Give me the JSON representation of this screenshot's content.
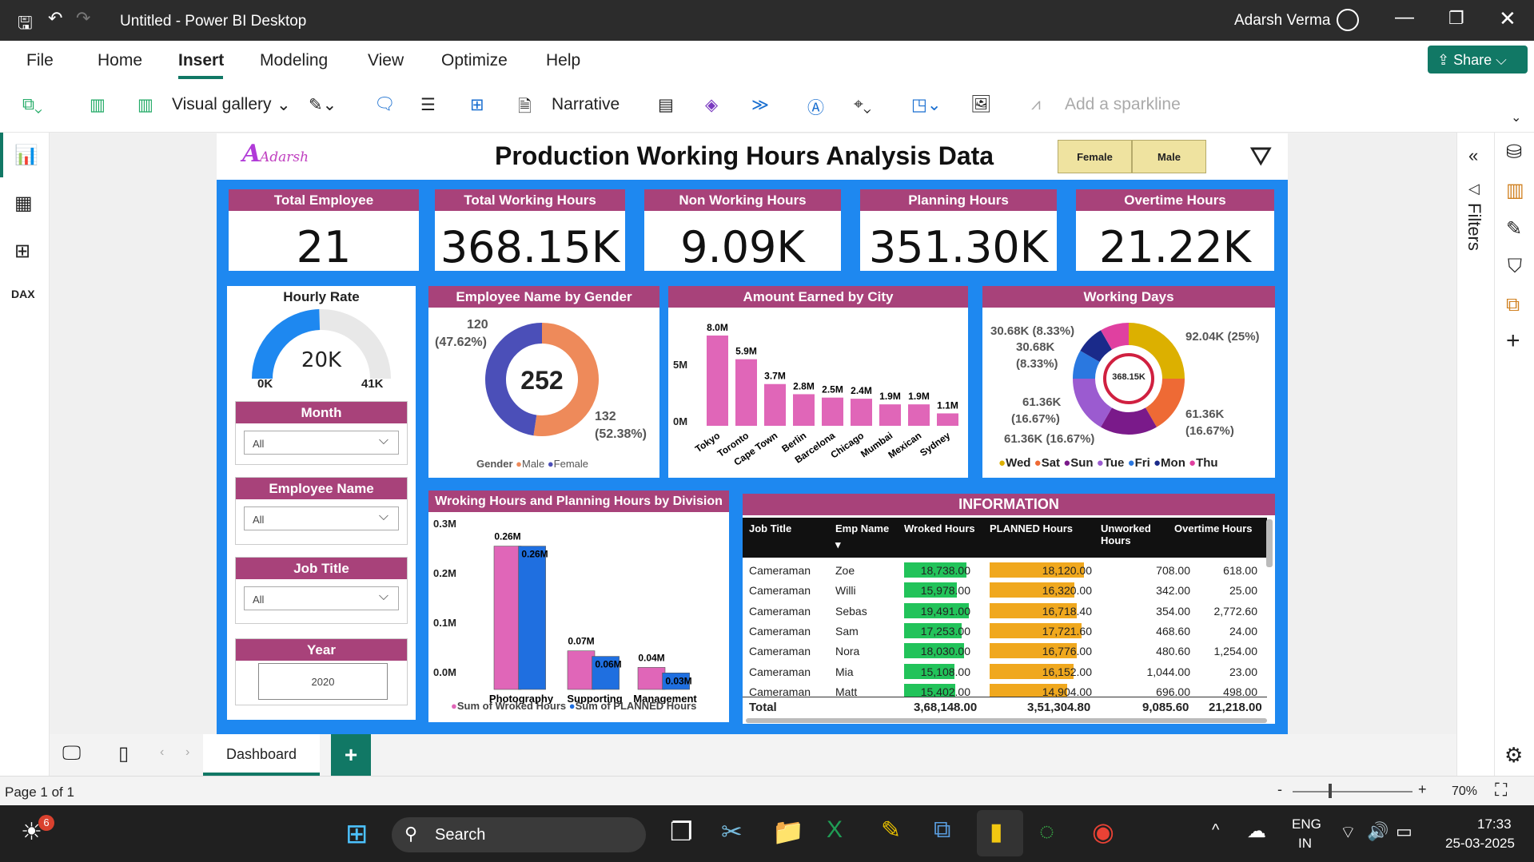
{
  "window": {
    "title": "Untitled - Power BI Desktop",
    "user": "Adarsh Verma"
  },
  "menu": [
    "File",
    "Home",
    "Insert",
    "Modeling",
    "View",
    "Optimize",
    "Help"
  ],
  "share": "Share",
  "toolbar": {
    "visual_gallery": "Visual gallery",
    "narrative": "Narrative",
    "sparkline": "Add a sparkline"
  },
  "filters_label": "Filters",
  "report": {
    "title": "Production Working Hours Analysis Data",
    "logo": "Adarsh",
    "gender_buttons": [
      "Female",
      "Male"
    ],
    "kpis": [
      {
        "label": "Total Employee",
        "value": "21"
      },
      {
        "label": "Total Working Hours",
        "value": "368.15K"
      },
      {
        "label": "Non Working Hours",
        "value": "9.09K"
      },
      {
        "label": "Planning Hours",
        "value": "351.30K"
      },
      {
        "label": "Overtime Hours",
        "value": "21.22K"
      }
    ],
    "gauge": {
      "title": "Hourly Rate",
      "value": "20K",
      "min": "0K",
      "max": "41K",
      "fill": 0.49
    },
    "slicers": [
      {
        "title": "Month",
        "value": "All"
      },
      {
        "title": "Employee Name",
        "value": "All"
      },
      {
        "title": "Job Title",
        "value": "All"
      },
      {
        "title": "Year",
        "value": "2020"
      }
    ],
    "gender_chart": {
      "title": "Employee Name by Gender",
      "center": "252",
      "label_female": "120",
      "pct_female": "(47.62%)",
      "label_male": "132",
      "pct_male": "(52.38%)",
      "legend_title": "Gender",
      "legend": [
        "Male",
        "Female"
      ],
      "colors": {
        "male": "#ee8a5a",
        "female": "#4b4fb8"
      }
    },
    "city_chart": {
      "title": "Amount Earned by City",
      "yticks": [
        "5M",
        "0M"
      ]
    },
    "days_chart": {
      "title": "Working Days",
      "center": "368.15K",
      "labels": [
        "30.68K (8.33%)",
        "30.68K",
        "(8.33%)",
        "92.04K (25%)",
        "61.36K",
        "(16.67%)",
        "61.36K",
        "(16.67%)",
        "61.36K (16.67%)"
      ],
      "legend": [
        "Wed",
        "Sat",
        "Sun",
        "Tue",
        "Fri",
        "Mon",
        "Thu"
      ]
    },
    "division_chart": {
      "title": "Wroking Hours and Planning Hours by Division",
      "yticks": [
        "0.3M",
        "0.2M",
        "0.1M",
        "0.0M"
      ],
      "legend": [
        "Sum of Wroked Hours",
        "Sum of PLANNED Hours"
      ]
    },
    "table": {
      "title": "INFORMATION",
      "headers": [
        "Job Title",
        "Emp Name",
        "Wroked Hours",
        "PLANNED Hours",
        "Unworked Hours",
        "Overtime Hours"
      ],
      "rows": [
        [
          "Cameraman",
          "Zoe",
          "18,738.00",
          "18,120.00",
          "708.00",
          "618.00"
        ],
        [
          "Cameraman",
          "Willi",
          "15,978.00",
          "16,320.00",
          "342.00",
          "25.00"
        ],
        [
          "Cameraman",
          "Sebas",
          "19,491.00",
          "16,718.40",
          "354.00",
          "2,772.60"
        ],
        [
          "Cameraman",
          "Sam",
          "17,253.00",
          "17,721.60",
          "468.60",
          "24.00"
        ],
        [
          "Cameraman",
          "Nora",
          "18,030.00",
          "16,776.00",
          "480.60",
          "1,254.00"
        ],
        [
          "Cameraman",
          "Mia",
          "15,108.00",
          "16,152.00",
          "1,044.00",
          "23.00"
        ],
        [
          "Cameraman",
          "Matt",
          "15,402.00",
          "14,904.00",
          "696.00",
          "498.00"
        ]
      ],
      "total": [
        "Total",
        "",
        "3,68,148.00",
        "3,51,304.80",
        "9,085.60",
        "21,218.00"
      ]
    }
  },
  "chart_data": [
    {
      "type": "pie",
      "title": "Employee Name by Gender",
      "categories": [
        "Male",
        "Female"
      ],
      "values": [
        132,
        120
      ]
    },
    {
      "type": "bar",
      "title": "Amount Earned by City",
      "categories": [
        "Tokyo",
        "Toronto",
        "Cape Town",
        "Berlin",
        "Barcelona",
        "Chicago",
        "Mumbai",
        "Mexican",
        "Sydney"
      ],
      "values": [
        8.0,
        5.9,
        3.7,
        2.8,
        2.5,
        2.4,
        1.9,
        1.9,
        1.1
      ],
      "labels": [
        "8.0M",
        "5.9M",
        "3.7M",
        "2.8M",
        "2.5M",
        "2.4M",
        "1.9M",
        "1.9M",
        "1.1M"
      ],
      "ylim": [
        0,
        8
      ],
      "color": "#e066b8"
    },
    {
      "type": "pie",
      "title": "Working Days",
      "categories": [
        "Wed",
        "Sat",
        "Sun",
        "Tue",
        "Fri",
        "Mon",
        "Thu"
      ],
      "values": [
        92.04,
        61.36,
        61.36,
        61.36,
        30.68,
        30.68,
        30.68
      ],
      "colors": [
        "#dcb000",
        "#ee6a35",
        "#7a1a8a",
        "#9b5bd0",
        "#2a78e0",
        "#1a2a8a",
        "#e040a0"
      ]
    },
    {
      "type": "bar",
      "title": "Wroking Hours and Planning Hours by Division",
      "categories": [
        "Photography",
        "Supporting",
        "Management"
      ],
      "ylim": [
        0,
        0.3
      ],
      "series": [
        {
          "name": "Sum of Wroked Hours",
          "values": [
            0.26,
            0.07,
            0.04
          ],
          "labels": [
            "0.26M",
            "0.07M",
            "0.04M"
          ],
          "color": "#e066b8"
        },
        {
          "name": "Sum of PLANNED Hours",
          "values": [
            0.26,
            0.06,
            0.03
          ],
          "labels": [
            "0.26M",
            "0.06M",
            "0.03M"
          ],
          "color": "#1f6fe0"
        }
      ]
    }
  ],
  "tabs": {
    "page": "Dashboard",
    "page_info": "Page 1 of 1",
    "zoom": "70%"
  },
  "taskbar": {
    "search": "Search",
    "lang1": "ENG",
    "lang2": "IN",
    "time": "17:33",
    "date": "25-03-2025",
    "badge": "6"
  }
}
